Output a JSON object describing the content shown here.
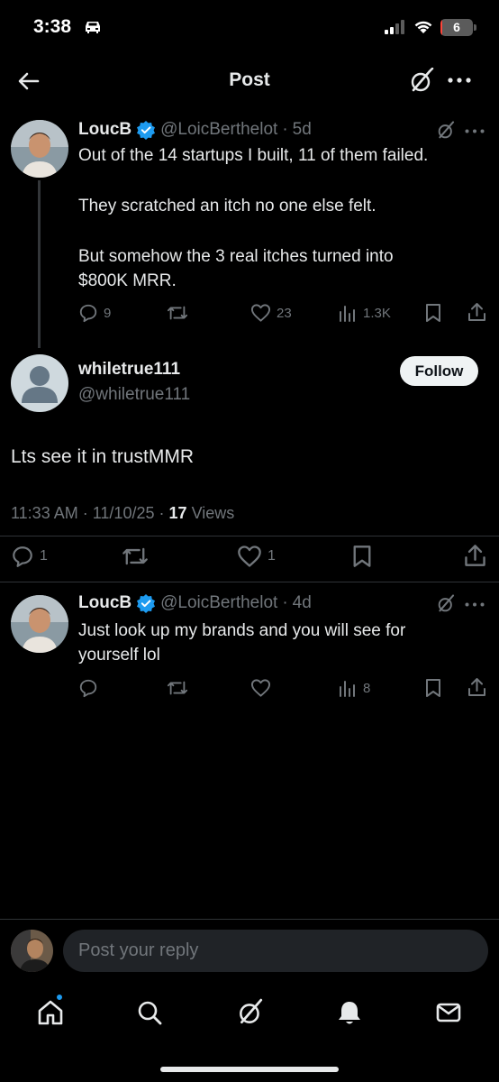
{
  "status_bar": {
    "time": "3:38",
    "battery": "6",
    "battery_level_percent": 6
  },
  "header": {
    "title": "Post"
  },
  "parent_tweet": {
    "name": "LoucB",
    "handle": "@LoicBerthelot",
    "separator": "·",
    "age": "5d",
    "lines": [
      "Out of the 14 startups I built, 11 of them failed.",
      "They scratched an itch no one else felt.",
      "But somehow the 3 real itches turned into\n$800K MRR."
    ],
    "replies": "9",
    "likes": "23",
    "views": "1.3K"
  },
  "main_tweet": {
    "name": "whiletrue111",
    "handle": "@whiletrue111",
    "follow_label": "Follow",
    "text": "Lts see it in trustMMR",
    "time": "11:33 AM",
    "date": "11/10/25",
    "separator": "·",
    "views_count": "17",
    "views_label": "Views",
    "replies": "1",
    "likes": "1"
  },
  "reply_tweet": {
    "name": "LoucB",
    "handle": "@LoicBerthelot",
    "separator": "·",
    "age": "4d",
    "text": "Just look up my brands and you will see for\nyourself lol",
    "views": "8"
  },
  "reply_bar": {
    "placeholder": "Post your reply"
  },
  "tab_bar": {
    "items": [
      "home-icon",
      "search-icon",
      "grok-icon",
      "notifications-icon",
      "messages-icon"
    ]
  },
  "colors": {
    "accent": "#1d9bf0",
    "muted": "#71767b",
    "text": "#e7e9ea",
    "background": "#000000",
    "battery_low": "#ff453a"
  }
}
